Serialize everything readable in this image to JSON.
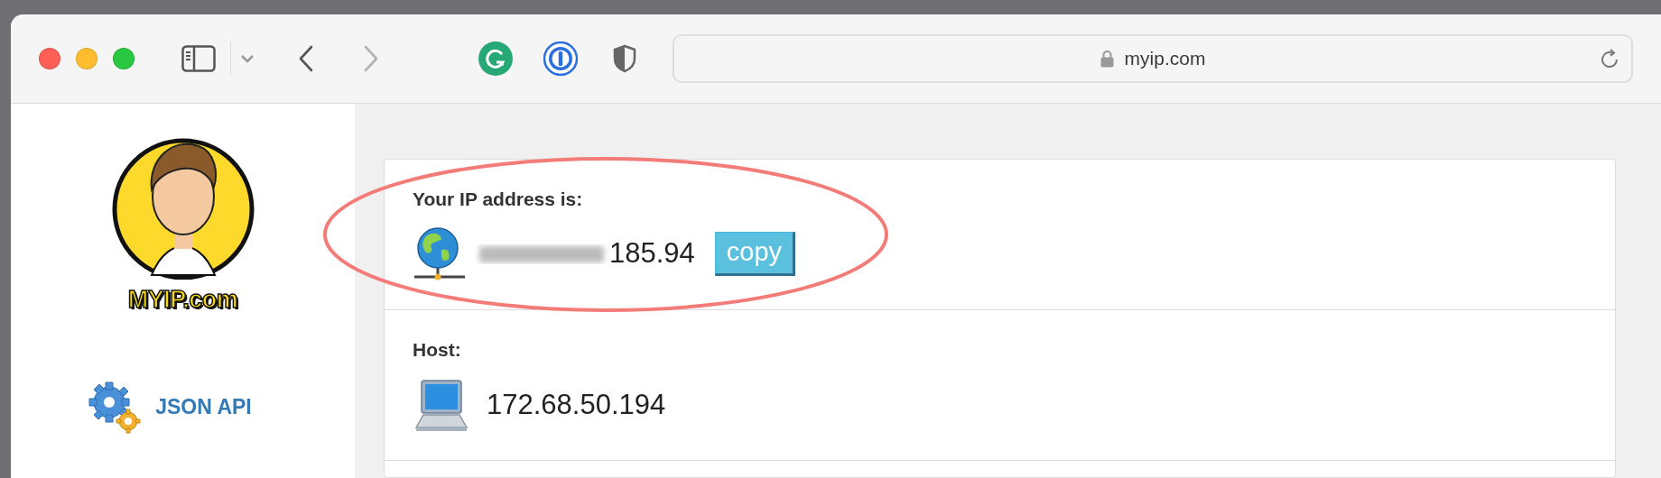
{
  "browser": {
    "back": {
      "disabled": false
    },
    "forward": {
      "disabled": true
    },
    "url": "myip.com"
  },
  "sidebar": {
    "logo_text": "MYIP.com",
    "links": [
      {
        "label": "JSON API"
      }
    ]
  },
  "sections": [
    {
      "kind": "ip",
      "label": "Your IP address is:",
      "redacted": true,
      "value": "185.94",
      "button": "copy"
    },
    {
      "kind": "host",
      "label": "Host:",
      "value": "172.68.50.194"
    }
  ]
}
